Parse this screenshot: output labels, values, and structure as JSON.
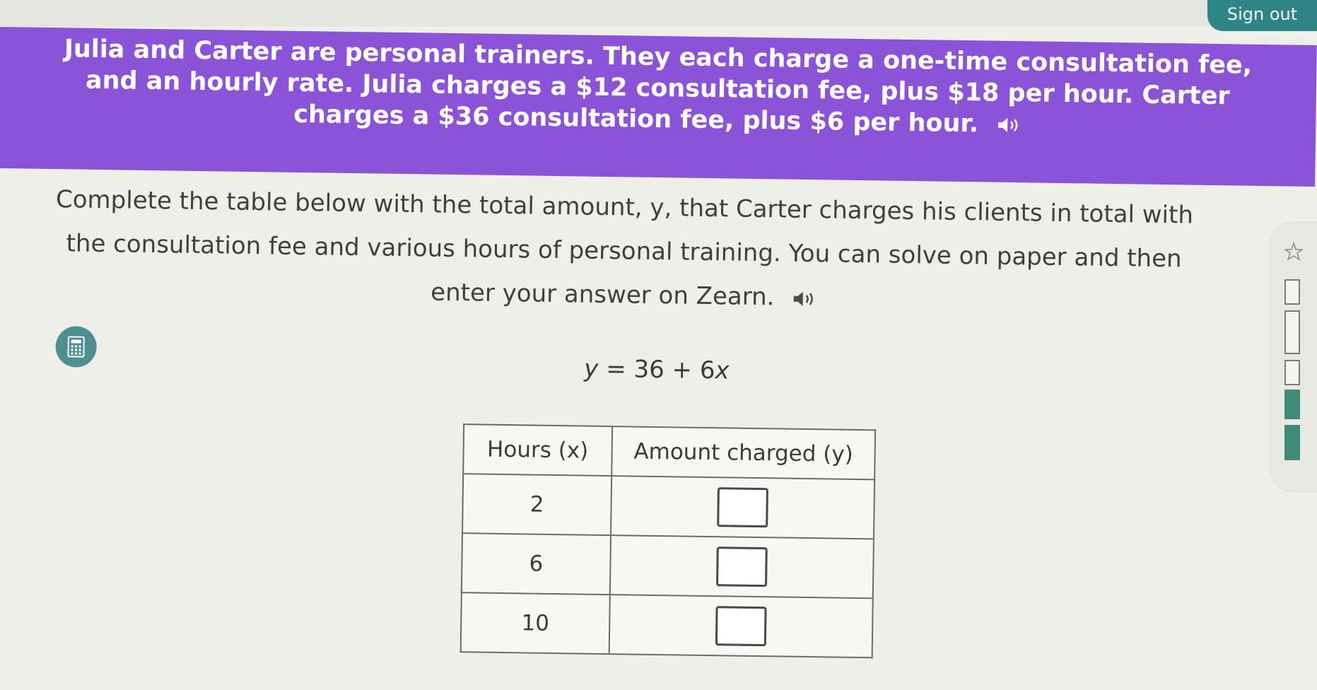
{
  "header": {
    "signout_label": "Sign out"
  },
  "problem": {
    "text": "Julia and Carter are personal trainers. They each charge a one-time consultation fee, and an hourly rate. Julia charges a $12 consultation fee, plus $18 per hour. Carter charges a $36 consultation fee, plus $6 per hour."
  },
  "instructions": {
    "text": "Complete the table below with the total amount, y, that Carter charges his clients in total with the consultation fee and various hours of personal training. You can solve on paper and then enter your answer on Zearn."
  },
  "equation": {
    "lhs": "y",
    "rhs": "= 36 + 6",
    "var": "x"
  },
  "table": {
    "headers": [
      "Hours (x)",
      "Amount charged (y)"
    ],
    "rows": [
      {
        "hours": "2",
        "amount": ""
      },
      {
        "hours": "6",
        "amount": ""
      },
      {
        "hours": "10",
        "amount": ""
      }
    ]
  },
  "icons": {
    "speaker": "speaker-icon",
    "calculator": "calculator-icon",
    "star": "star-icon"
  },
  "colors": {
    "banner": "#8a53d8",
    "signout": "#2f8585",
    "calculator": "#4f8f8f",
    "progress_fill": "#3f8a79"
  },
  "progress": {
    "segments_total": 5,
    "segments_filled": 2
  }
}
